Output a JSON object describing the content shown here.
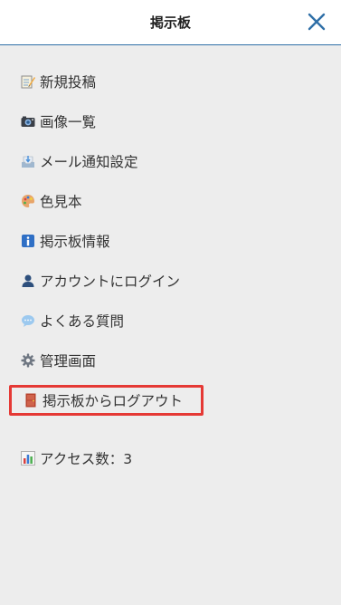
{
  "header": {
    "title": "掲示板",
    "close_icon": "close-icon"
  },
  "menu": {
    "items": [
      {
        "label": "新規投稿",
        "icon": "memo-icon"
      },
      {
        "label": "画像一覧",
        "icon": "camera-icon"
      },
      {
        "label": "メール通知設定",
        "icon": "inbox-tray-icon"
      },
      {
        "label": "色見本",
        "icon": "palette-icon"
      },
      {
        "label": "掲示板情報",
        "icon": "information-icon"
      },
      {
        "label": "アカウントにログイン",
        "icon": "user-icon"
      },
      {
        "label": "よくある質問",
        "icon": "speech-balloon-icon"
      },
      {
        "label": "管理画面",
        "icon": "gear-icon"
      },
      {
        "label": "掲示板からログアウト",
        "icon": "door-icon"
      }
    ]
  },
  "access": {
    "label": "アクセス数：3",
    "icon": "bar-chart-icon"
  },
  "colors": {
    "accent": "#2f6fa7",
    "highlight_border": "#e53935",
    "background": "#ededed"
  }
}
